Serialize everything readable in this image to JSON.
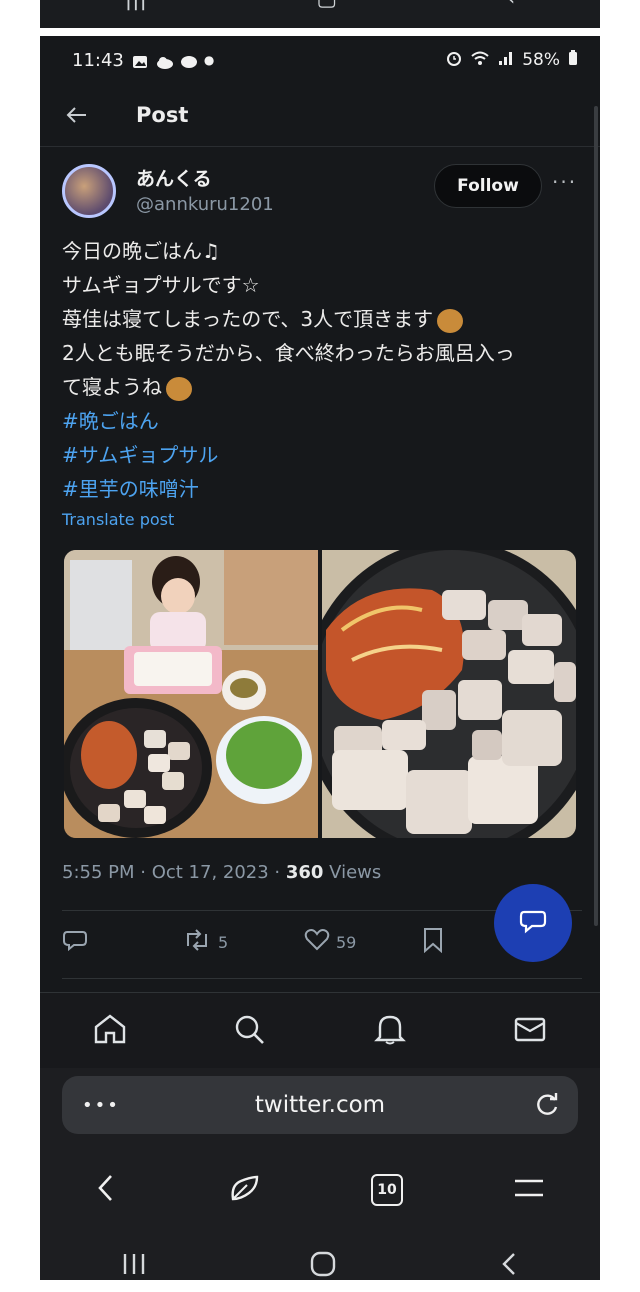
{
  "status_bar": {
    "time": "11:43",
    "battery": "58%"
  },
  "header": {
    "title": "Post"
  },
  "post": {
    "author_name": "あんくる",
    "author_handle": "@annkuru1201",
    "follow_label": "Follow",
    "lines": [
      "今日の晩ごはん♫",
      "サムギョプサルです☆",
      "苺佳は寝てしまったので、3人で頂きます",
      "2人とも眠そうだから、食べ終わったらお風呂入っ",
      "て寝ようね"
    ],
    "hashtags": [
      "#晩ごはん",
      "#サムギョプサル",
      "#里芋の味噌汁"
    ],
    "translate_label": "Translate post",
    "timestamp": "5:55 PM · Oct 17, 2023 · ",
    "views_count": "360",
    "views_label": " Views"
  },
  "actions": {
    "retweets": "5",
    "likes": "59"
  },
  "browser": {
    "url": "twitter.com",
    "tab_count": "10"
  },
  "colors": {
    "background": "#16181b",
    "link": "#4da3f0",
    "fab": "#1d3fb3"
  },
  "icons": [
    "back-arrow-icon",
    "more-icon",
    "reply-icon",
    "retweet-icon",
    "heart-icon",
    "bookmark-icon",
    "compose-icon",
    "home-icon",
    "search-icon",
    "bell-icon",
    "mail-icon",
    "reload-icon",
    "browser-back-icon",
    "bookmark-flower-icon",
    "menu-icon"
  ]
}
